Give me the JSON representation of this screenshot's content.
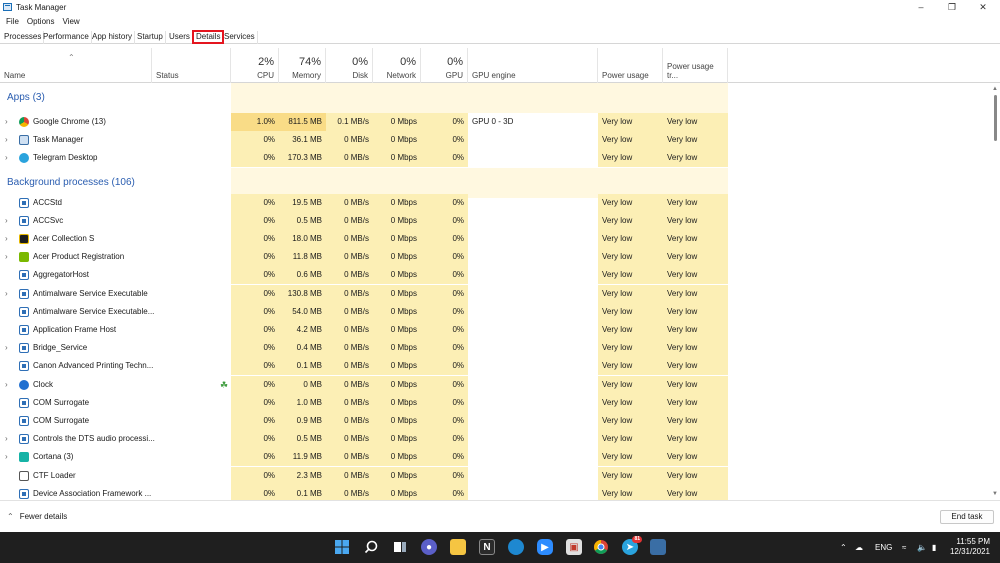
{
  "window": {
    "title": "Task Manager"
  },
  "menu": [
    "File",
    "Options",
    "View"
  ],
  "tabs": [
    "Processes",
    "Performance",
    "App history",
    "Startup",
    "Users",
    "Details",
    "Services"
  ],
  "header": {
    "name": "Name",
    "status": "Status",
    "cpu": {
      "pct": "2%",
      "label": "CPU"
    },
    "memory": {
      "pct": "74%",
      "label": "Memory"
    },
    "disk": {
      "pct": "0%",
      "label": "Disk"
    },
    "network": {
      "pct": "0%",
      "label": "Network"
    },
    "gpu": {
      "pct": "0%",
      "label": "GPU"
    },
    "gpu_engine": "GPU engine",
    "power": "Power usage",
    "power_trend": "Power usage tr..."
  },
  "groups": {
    "apps": "Apps (3)",
    "background": "Background processes (106)"
  },
  "apps": [
    {
      "name": "Google Chrome (13)",
      "cpu": "1.0%",
      "mem": "811.5 MB",
      "disk": "0.1 MB/s",
      "net": "0 Mbps",
      "gpu": "0%",
      "engine": "GPU 0 - 3D",
      "power": "Very low",
      "trend": "Very low"
    },
    {
      "name": "Task Manager",
      "cpu": "0%",
      "mem": "36.1 MB",
      "disk": "0 MB/s",
      "net": "0 Mbps",
      "gpu": "0%",
      "engine": "",
      "power": "Very low",
      "trend": "Very low"
    },
    {
      "name": "Telegram Desktop",
      "cpu": "0%",
      "mem": "170.3 MB",
      "disk": "0 MB/s",
      "net": "0 Mbps",
      "gpu": "0%",
      "engine": "",
      "power": "Very low",
      "trend": "Very low"
    }
  ],
  "background": [
    {
      "name": "ACCStd",
      "cpu": "0%",
      "mem": "19.5 MB",
      "disk": "0 MB/s",
      "net": "0 Mbps",
      "gpu": "0%",
      "power": "Very low",
      "trend": "Very low"
    },
    {
      "name": "ACCSvc",
      "cpu": "0%",
      "mem": "0.5 MB",
      "disk": "0 MB/s",
      "net": "0 Mbps",
      "gpu": "0%",
      "power": "Very low",
      "trend": "Very low"
    },
    {
      "name": "Acer Collection S",
      "cpu": "0%",
      "mem": "18.0 MB",
      "disk": "0 MB/s",
      "net": "0 Mbps",
      "gpu": "0%",
      "power": "Very low",
      "trend": "Very low"
    },
    {
      "name": "Acer Product Registration",
      "cpu": "0%",
      "mem": "11.8 MB",
      "disk": "0 MB/s",
      "net": "0 Mbps",
      "gpu": "0%",
      "power": "Very low",
      "trend": "Very low"
    },
    {
      "name": "AggregatorHost",
      "cpu": "0%",
      "mem": "0.6 MB",
      "disk": "0 MB/s",
      "net": "0 Mbps",
      "gpu": "0%",
      "power": "Very low",
      "trend": "Very low"
    },
    {
      "name": "Antimalware Service Executable",
      "cpu": "0%",
      "mem": "130.8 MB",
      "disk": "0 MB/s",
      "net": "0 Mbps",
      "gpu": "0%",
      "power": "Very low",
      "trend": "Very low"
    },
    {
      "name": "Antimalware Service Executable...",
      "cpu": "0%",
      "mem": "54.0 MB",
      "disk": "0 MB/s",
      "net": "0 Mbps",
      "gpu": "0%",
      "power": "Very low",
      "trend": "Very low"
    },
    {
      "name": "Application Frame Host",
      "cpu": "0%",
      "mem": "4.2 MB",
      "disk": "0 MB/s",
      "net": "0 Mbps",
      "gpu": "0%",
      "power": "Very low",
      "trend": "Very low"
    },
    {
      "name": "Bridge_Service",
      "cpu": "0%",
      "mem": "0.4 MB",
      "disk": "0 MB/s",
      "net": "0 Mbps",
      "gpu": "0%",
      "power": "Very low",
      "trend": "Very low"
    },
    {
      "name": "Canon Advanced Printing Techn...",
      "cpu": "0%",
      "mem": "0.1 MB",
      "disk": "0 MB/s",
      "net": "0 Mbps",
      "gpu": "0%",
      "power": "Very low",
      "trend": "Very low"
    },
    {
      "name": "Clock",
      "cpu": "0%",
      "mem": "0 MB",
      "disk": "0 MB/s",
      "net": "0 Mbps",
      "gpu": "0%",
      "power": "Very low",
      "trend": "Very low"
    },
    {
      "name": "COM Surrogate",
      "cpu": "0%",
      "mem": "1.0 MB",
      "disk": "0 MB/s",
      "net": "0 Mbps",
      "gpu": "0%",
      "power": "Very low",
      "trend": "Very low"
    },
    {
      "name": "COM Surrogate",
      "cpu": "0%",
      "mem": "0.9 MB",
      "disk": "0 MB/s",
      "net": "0 Mbps",
      "gpu": "0%",
      "power": "Very low",
      "trend": "Very low"
    },
    {
      "name": "Controls the DTS audio processi...",
      "cpu": "0%",
      "mem": "0.5 MB",
      "disk": "0 MB/s",
      "net": "0 Mbps",
      "gpu": "0%",
      "power": "Very low",
      "trend": "Very low"
    },
    {
      "name": "Cortana (3)",
      "cpu": "0%",
      "mem": "11.9 MB",
      "disk": "0 MB/s",
      "net": "0 Mbps",
      "gpu": "0%",
      "power": "Very low",
      "trend": "Very low"
    },
    {
      "name": "CTF Loader",
      "cpu": "0%",
      "mem": "2.3 MB",
      "disk": "0 MB/s",
      "net": "0 Mbps",
      "gpu": "0%",
      "power": "Very low",
      "trend": "Very low"
    },
    {
      "name": "Device Association Framework ...",
      "cpu": "0%",
      "mem": "0.1 MB",
      "disk": "0 MB/s",
      "net": "0 Mbps",
      "gpu": "0%",
      "power": "Very low",
      "trend": "Very low"
    }
  ],
  "footer": {
    "fewer": "Fewer details",
    "end_task": "End task"
  },
  "taskbar": {
    "telegram_badge": "81",
    "lang": "ENG",
    "time": "11:55 PM",
    "date": "12/31/2021"
  },
  "icons": {
    "chrome": "chrome-icon",
    "task_manager": "task-manager-icon",
    "telegram": "telegram-icon",
    "service": "service-window-icon",
    "acer": "acer-icon",
    "nvidia": "registration-icon",
    "clock": "clock-icon",
    "cortana": "cortana-icon",
    "ctf": "pen-icon",
    "leaf": "efficiency-leaf-icon"
  }
}
